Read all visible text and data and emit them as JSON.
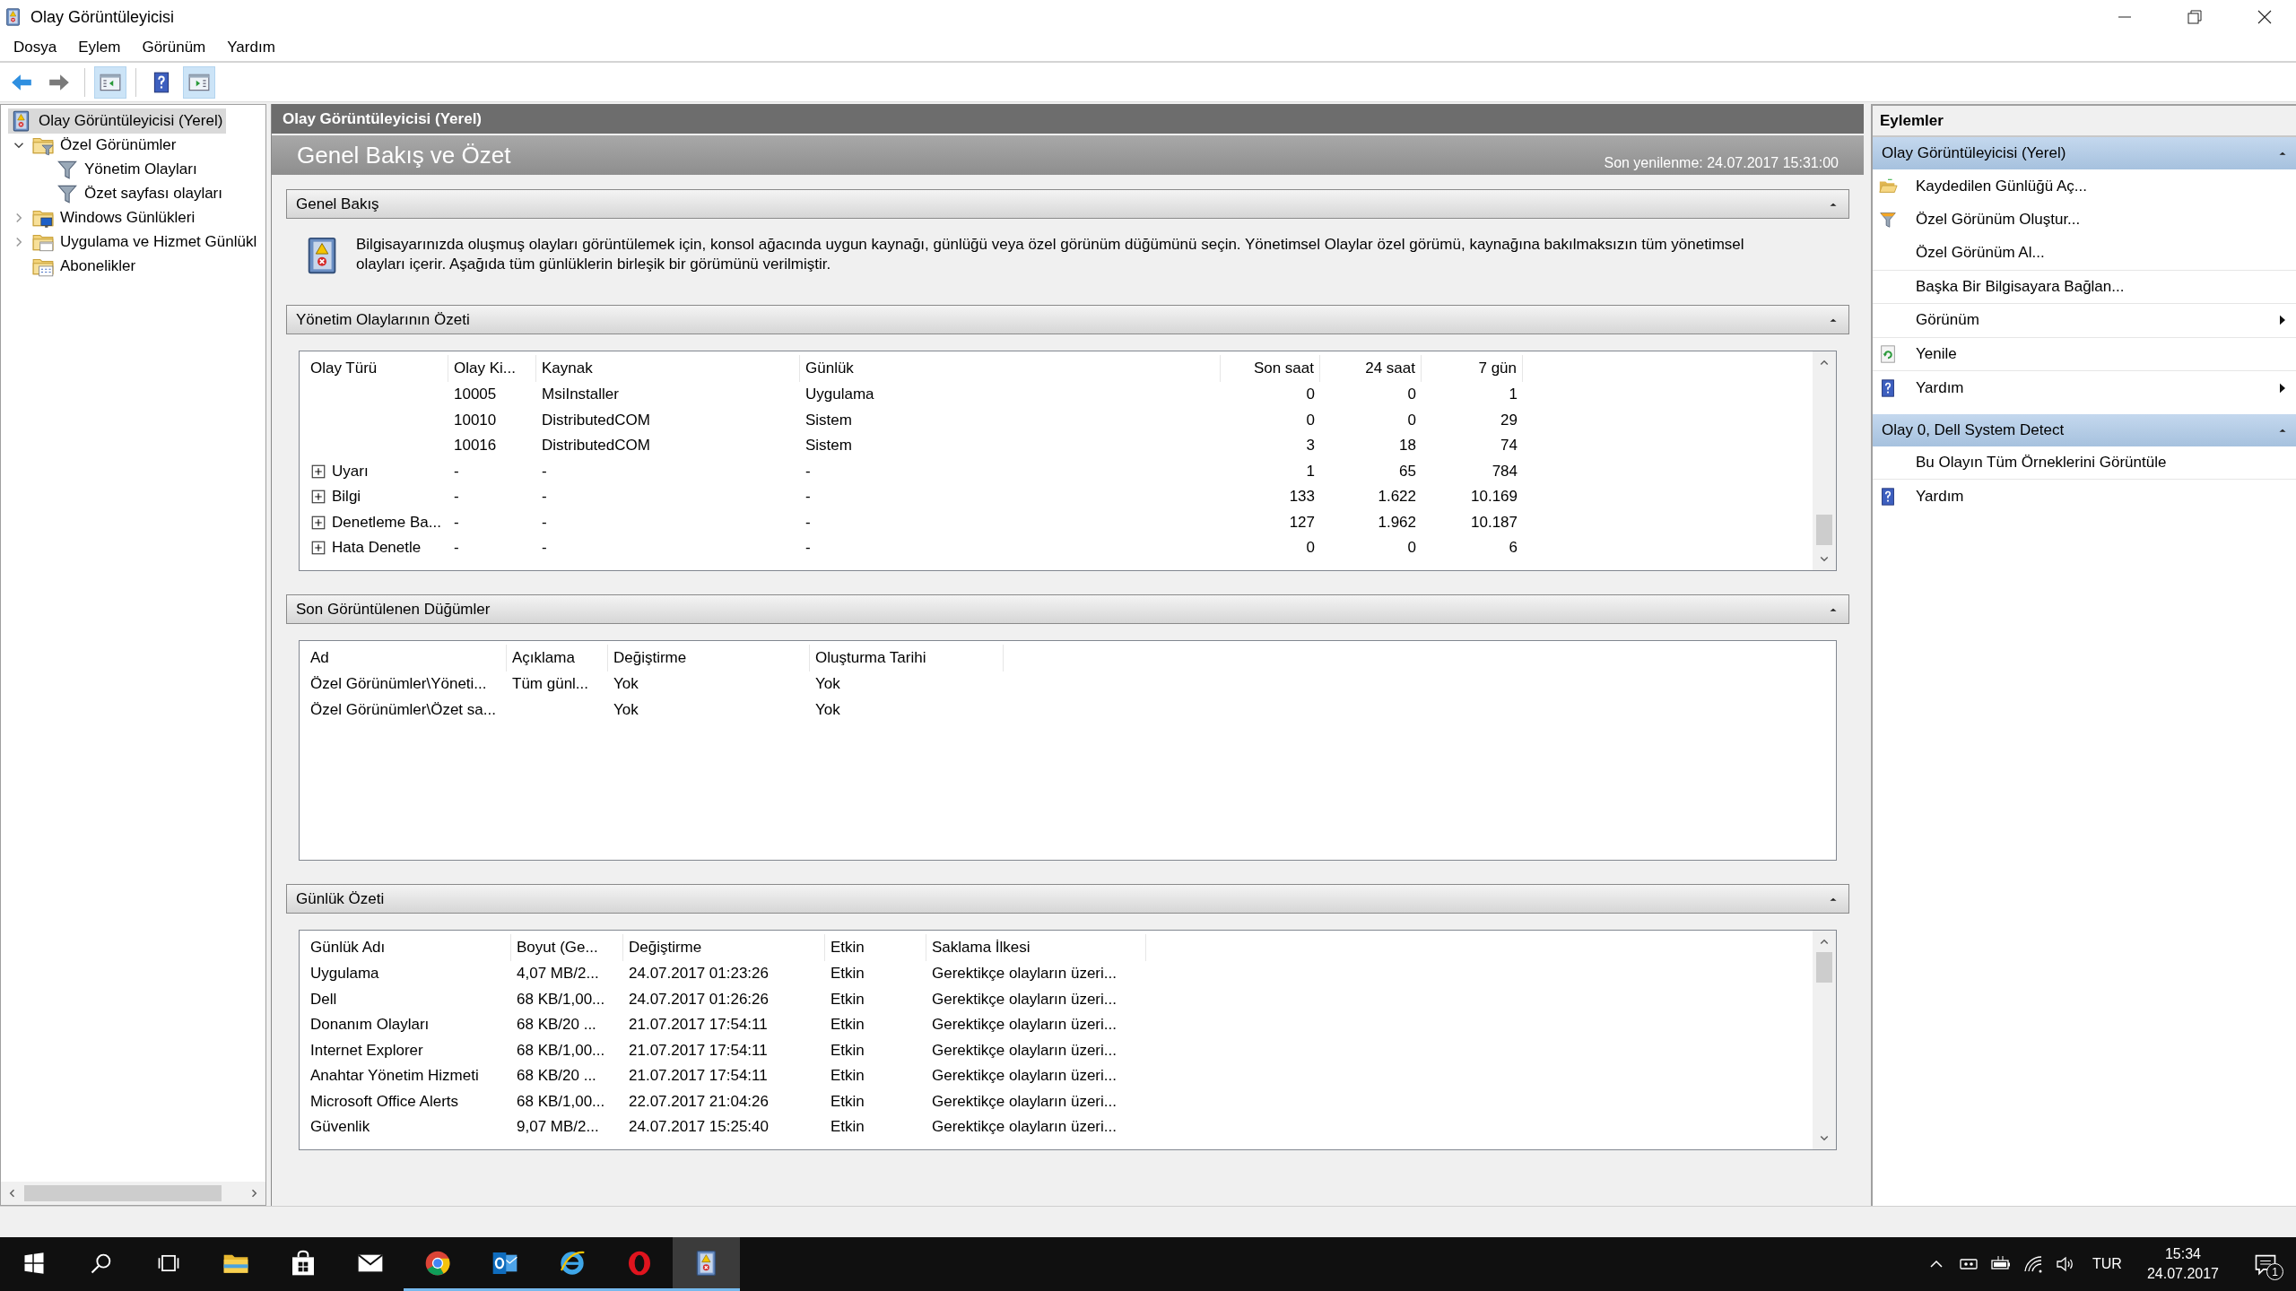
{
  "window": {
    "title": "Olay Görüntüleyicisi"
  },
  "menu": [
    "Dosya",
    "Eylem",
    "Görünüm",
    "Yardım"
  ],
  "toolbar": [
    {
      "kind": "back",
      "on": false
    },
    {
      "kind": "forward",
      "on": false
    },
    {
      "kind": "show-tree",
      "on": true
    },
    {
      "kind": "help",
      "on": false
    },
    {
      "kind": "show-actions",
      "on": true
    }
  ],
  "tree": [
    {
      "label": "Olay Görüntüleyicisi (Yerel)",
      "kind": "app",
      "selected": true,
      "children": [
        {
          "label": "Özel Görünümler",
          "kind": "folder-filter",
          "selected": false,
          "expanded": true,
          "children": [
            {
              "label": "Yönetim Olayları",
              "kind": "filter",
              "selected": false
            },
            {
              "label": "Özet sayfası olayları",
              "kind": "filter",
              "selected": false
            }
          ]
        },
        {
          "label": "Windows Günlükleri",
          "kind": "folder-windows",
          "selected": false,
          "expanded": false
        },
        {
          "label": "Uygulama ve Hizmet Günlükl",
          "kind": "folder-app",
          "selected": false,
          "expanded": false
        },
        {
          "label": "Abonelikler",
          "kind": "folder-subs",
          "selected": false
        }
      ]
    }
  ],
  "center": {
    "header": "Olay Görüntüleyicisi (Yerel)",
    "title": "Genel Bakış ve Özet",
    "refreshed": "Son yenilenme: 24.07.2017 15:31:00",
    "sections": [
      {
        "kind": "text",
        "title": "Genel Bakış",
        "expanded": true,
        "text": "Bilgisayarınızda oluşmuş olayları görüntülemek için, konsol ağacında uygun kaynağı, günlüğü veya özel görünüm düğümünü seçin. Yönetimsel Olaylar özel görümü, kaynağına bakılmaksızın tüm yönetimsel olayları içerir. Aşağıda tüm günlüklerin birleşik bir görümünü verilmiştir."
      },
      {
        "kind": "table",
        "title": "Yönetim Olaylarının Özeti",
        "expanded": true,
        "scrollable": true,
        "scrolled_to_end": true,
        "columns": [
          {
            "label": "Olay Türü",
            "kind": "text"
          },
          {
            "label": "Olay Ki...",
            "kind": "text"
          },
          {
            "label": "Kaynak",
            "kind": "text"
          },
          {
            "label": "Günlük",
            "kind": "text"
          },
          {
            "label": "Son saat",
            "kind": "number"
          },
          {
            "label": "24 saat",
            "kind": "number"
          },
          {
            "label": "7 gün",
            "kind": "number"
          }
        ],
        "rows": [
          {
            "cells": [
              null,
              "10005",
              "MsiInstaller",
              "Uygulama",
              "0",
              "0",
              "1"
            ]
          },
          {
            "cells": [
              null,
              "10010",
              "DistributedCOM",
              "Sistem",
              "0",
              "0",
              "29"
            ]
          },
          {
            "cells": [
              null,
              "10016",
              "DistributedCOM",
              "Sistem",
              "3",
              "18",
              "74"
            ]
          },
          {
            "expanded": false,
            "cells": [
              "Uyarı",
              "-",
              "-",
              "-",
              "1",
              "65",
              "784"
            ]
          },
          {
            "expanded": false,
            "cells": [
              "Bilgi",
              "-",
              "-",
              "-",
              "133",
              "1.622",
              "10.169"
            ]
          },
          {
            "expanded": false,
            "cells": [
              "Denetleme Ba...",
              "-",
              "-",
              "-",
              "127",
              "1.962",
              "10.187"
            ]
          },
          {
            "expanded": false,
            "cells": [
              "Hata Denetle",
              "-",
              "-",
              "-",
              "0",
              "0",
              "6"
            ]
          }
        ]
      },
      {
        "kind": "table",
        "title": "Son Görüntülenen Düğümler",
        "expanded": true,
        "columns": [
          {
            "label": "Ad",
            "kind": "text"
          },
          {
            "label": "Açıklama",
            "kind": "text"
          },
          {
            "label": "Değiştirme",
            "kind": "text"
          },
          {
            "label": "Oluşturma Tarihi",
            "kind": "text"
          }
        ],
        "rows": [
          {
            "cells": [
              "Özel Görünümler\\Yöneti...",
              "Tüm günl...",
              "Yok",
              "Yok"
            ]
          },
          {
            "cells": [
              "Özel Görünümler\\Özet sa...",
              null,
              "Yok",
              "Yok"
            ]
          }
        ]
      },
      {
        "kind": "table",
        "title": "Günlük Özeti",
        "expanded": true,
        "scrollable": true,
        "scrolled_to_end": false,
        "columns": [
          {
            "label": "Günlük Adı",
            "kind": "text"
          },
          {
            "label": "Boyut (Ge...",
            "kind": "text"
          },
          {
            "label": "Değiştirme",
            "kind": "text"
          },
          {
            "label": "Etkin",
            "kind": "text"
          },
          {
            "label": "Saklama İlkesi",
            "kind": "text"
          }
        ],
        "rows": [
          {
            "cells": [
              "Uygulama",
              "4,07 MB/2...",
              "24.07.2017 01:23:26",
              "Etkin",
              "Gerektikçe olayların üzeri..."
            ]
          },
          {
            "cells": [
              "Dell",
              "68 KB/1,00...",
              "24.07.2017 01:26:26",
              "Etkin",
              "Gerektikçe olayların üzeri..."
            ]
          },
          {
            "cells": [
              "Donanım Olayları",
              "68 KB/20 ...",
              "21.07.2017 17:54:11",
              "Etkin",
              "Gerektikçe olayların üzeri..."
            ]
          },
          {
            "cells": [
              "Internet Explorer",
              "68 KB/1,00...",
              "21.07.2017 17:54:11",
              "Etkin",
              "Gerektikçe olayların üzeri..."
            ]
          },
          {
            "cells": [
              "Anahtar Yönetim Hizmeti",
              "68 KB/20 ...",
              "21.07.2017 17:54:11",
              "Etkin",
              "Gerektikçe olayların üzeri..."
            ]
          },
          {
            "cells": [
              "Microsoft Office Alerts",
              "68 KB/1,00...",
              "22.07.2017 21:04:26",
              "Etkin",
              "Gerektikçe olayların üzeri..."
            ]
          },
          {
            "cells": [
              "Güvenlik",
              "9,07 MB/2...",
              "24.07.2017 15:25:40",
              "Etkin",
              "Gerektikçe olayların üzeri..."
            ]
          }
        ]
      }
    ]
  },
  "actions": {
    "title": "Eylemler",
    "groups": [
      {
        "title": "Olay Görüntüleyicisi (Yerel)",
        "expanded": true,
        "items": [
          {
            "label": "Kaydedilen Günlüğü Aç...",
            "kind": "open-log",
            "submenu": false
          },
          {
            "label": "Özel Görünüm Oluştur...",
            "kind": "create-view",
            "submenu": false
          },
          {
            "label": "Özel Görünüm Al...",
            "kind": "none",
            "submenu": false
          },
          {
            "label": "Başka Bir Bilgisayara Bağlan...",
            "kind": "none",
            "submenu": false
          },
          {
            "label": "Görünüm",
            "kind": "none",
            "submenu": true
          },
          {
            "label": "Yenile",
            "kind": "refresh",
            "submenu": false
          },
          {
            "label": "Yardım",
            "kind": "help",
            "submenu": true
          }
        ]
      },
      {
        "title": "Olay 0, Dell System Detect",
        "expanded": true,
        "items": [
          {
            "label": "Bu Olayın Tüm Örneklerini Görüntüle",
            "kind": "none",
            "submenu": false
          },
          {
            "label": "Yardım",
            "kind": "help",
            "submenu": false
          }
        ]
      }
    ]
  },
  "taskbar": {
    "buttons": [
      {
        "kind": "start"
      },
      {
        "kind": "search"
      },
      {
        "kind": "task-view"
      }
    ],
    "apps": [
      {
        "kind": "explorer",
        "running": false,
        "selected": false
      },
      {
        "kind": "store",
        "running": false,
        "selected": false
      },
      {
        "kind": "mail",
        "running": false,
        "selected": false
      },
      {
        "kind": "chrome",
        "running": true,
        "selected": false
      },
      {
        "kind": "outlook",
        "running": true,
        "selected": false
      },
      {
        "kind": "ie",
        "running": true,
        "selected": false
      },
      {
        "kind": "opera",
        "running": true,
        "selected": false
      },
      {
        "kind": "app",
        "running": true,
        "selected": true
      }
    ],
    "tray": {
      "language": "TUR",
      "time": "15:34",
      "date": "24.07.2017",
      "notifications": "1"
    }
  }
}
